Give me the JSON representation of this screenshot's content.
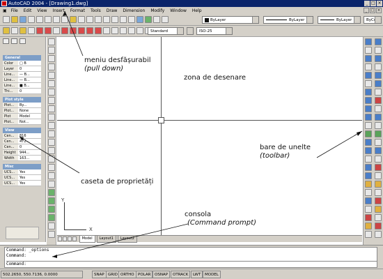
{
  "window": {
    "title": "AutoCAD 2004 - [Drawing1.dwg]"
  },
  "menubar": {
    "items": [
      "File",
      "Edit",
      "View",
      "Insert",
      "Format",
      "Tools",
      "Draw",
      "Dimension",
      "Modify",
      "Window",
      "Help"
    ]
  },
  "toolbars": {
    "layer_combo": "ByLayer",
    "linetype_combo": "ByLayer",
    "lineweight_combo": "ByLayer",
    "color_combo": "ByColor",
    "textstyle_combo": "Standard",
    "dimstyle_combo": "ISO-25"
  },
  "properties": {
    "sections": [
      {
        "title": "General",
        "rows": [
          [
            "Color",
            "□ B"
          ],
          [
            "Layer",
            "0"
          ],
          [
            "Line...",
            "— B..."
          ],
          [
            "Line...",
            "— B..."
          ],
          [
            "Line...",
            "■ B..."
          ],
          [
            "Thi...",
            "0"
          ]
        ]
      },
      {
        "title": "Plot style",
        "rows": [
          [
            "Plot...",
            "By..."
          ],
          [
            "Plot...",
            "None"
          ],
          [
            "Plot",
            "Model"
          ],
          [
            "Plot...",
            "Not..."
          ]
        ]
      },
      {
        "title": "View",
        "rows": [
          [
            "Cen...",
            "816"
          ],
          [
            "Cen...",
            "472..."
          ],
          [
            "Cen...",
            "0"
          ],
          [
            "Height",
            "944..."
          ],
          [
            "Width",
            "163..."
          ]
        ]
      },
      {
        "title": "Misc",
        "rows": [
          [
            "UCS...",
            "Yes"
          ],
          [
            "UCS...",
            "Yes"
          ],
          [
            "UCS...",
            "Yes"
          ]
        ]
      }
    ]
  },
  "axes": {
    "x": "X",
    "y": "Y"
  },
  "layout_tabs": [
    "Model",
    "Layout1",
    "Layout2"
  ],
  "command": {
    "line1": "Command: _options",
    "line2": "Command:",
    "line3": "Command:"
  },
  "status": {
    "coords": "502.2650, 550.7136, 0.0000",
    "buttons": [
      "SNAP",
      "GRID",
      "ORTHO",
      "POLAR",
      "OSNAP",
      "OTRACK",
      "LWT",
      "MODEL"
    ]
  },
  "annotations": {
    "menu_line1": "meniu desfășurabil",
    "menu_line2": "(pull down)",
    "drawing_area": "zona de desenare",
    "toolbar_line1": "bare de unelte",
    "toolbar_line2": "(toolbar)",
    "properties": "caseta de proprietăți",
    "console_line1": "consola",
    "console_line2": "(Command prompt)"
  }
}
